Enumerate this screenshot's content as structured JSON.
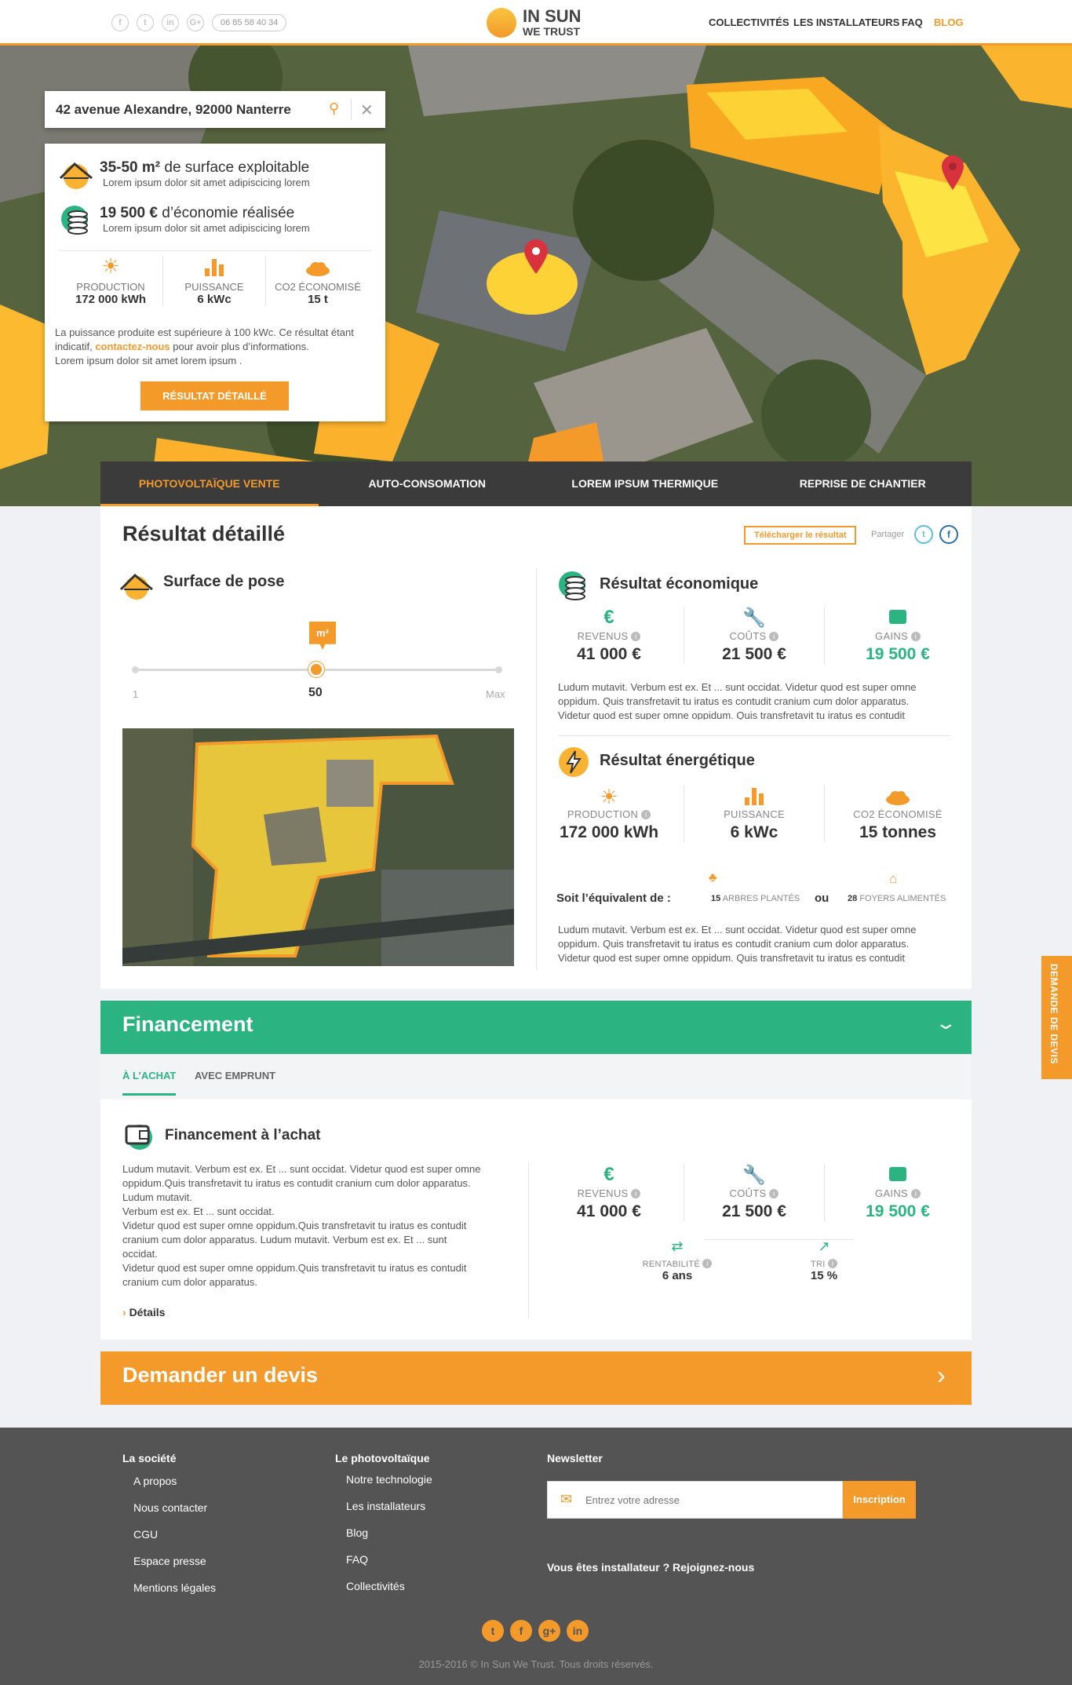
{
  "header": {
    "phone": "06 85 58 40 34",
    "logo_top": "IN SUN",
    "logo_bottom": "WE TRUST",
    "social": [
      "f",
      "t",
      "in",
      "G+"
    ],
    "nav": [
      "COLLECTIVITÉS",
      "LES INSTALLATEURS",
      "FAQ",
      "BLOG"
    ]
  },
  "search": {
    "value": "42 avenue Alexandre, 92000 Nanterre"
  },
  "summary": {
    "surface_bold": "35-50 m²",
    "surface_rest": " de surface exploitable",
    "surface_sub": "Lorem ipsum dolor sit amet adipiscicing lorem",
    "eco_bold": "19 500 €",
    "eco_rest": " d’économie réalisée",
    "eco_sub": "Lorem ipsum dolor sit amet adipiscicing lorem",
    "stats": [
      {
        "label": "PRODUCTION",
        "value": "172 000 kWh"
      },
      {
        "label": "PUISSANCE",
        "value": "6 kWc"
      },
      {
        "label": "CO2 ÉCONOMISÉ",
        "value": "15 t"
      }
    ],
    "note_1": "La puissance produite est supérieure à 100 kWc. Ce résultat étant",
    "note_2a": "indicatif, ",
    "note_link": "contactez-nous",
    "note_2b": " pour avoir plus d’informations.",
    "note_3": "Lorem ipsum dolor sit amet lorem ipsum .",
    "button": "RÉSULTAT DÉTAILLÉ"
  },
  "tabs": [
    "PHOTOVOLTAÏQUE VENTE",
    "AUTO-CONSOMATION",
    "LOREM IPSUM THERMIQUE",
    "REPRISE DE CHANTIER"
  ],
  "result": {
    "title": "Résultat détaillé",
    "download": "Télécharger le résultat",
    "share": "Partager",
    "surface_title": "Surface de pose",
    "slider_unit": "m²",
    "slider_min": "1",
    "slider_value": "50",
    "slider_max": "Max",
    "slider_level": 0.5,
    "eco_title": "Résultat économique",
    "eco": [
      {
        "label": "REVENUS",
        "value": "41 000 €"
      },
      {
        "label": "COÛTS",
        "value": "21 500 €"
      },
      {
        "label": "GAINS",
        "value": "19 500 €"
      }
    ],
    "eco_text": [
      "Ludum mutavit. Verbum est ex. Et ... sunt occidat. Videtur quod est super omne",
      "oppidum. Quis transfretavit tu iratus es contudit cranium cum dolor apparatus.",
      "Videtur quod est super omne oppidum. Quis transfretavit tu iratus es contudit"
    ],
    "energy_title": "Résultat énergétique",
    "energy": [
      {
        "label": "PRODUCTION",
        "value": "172 000 kWh"
      },
      {
        "label": "PUISSANCE",
        "value": "6 kWc"
      },
      {
        "label": "CO2 ÉCONOMISÉ",
        "value": "15 tonnes"
      }
    ],
    "equiv_label": "Soit l’équivalent de :",
    "trees_n": "15",
    "trees": "ARBRES PLANTÉS",
    "or": "ou",
    "homes_n": "28",
    "homes": "FOYERS ALIMENTÉS",
    "energy_text": [
      "Ludum mutavit. Verbum est ex. Et ... sunt occidat. Videtur quod est super omne",
      "oppidum. Quis transfretavit tu iratus es contudit cranium cum dolor apparatus.",
      "Videtur quod est super omne oppidum. Quis transfretavit tu iratus es contudit"
    ]
  },
  "financing": {
    "title": "Financement",
    "tabs": [
      "À L’ACHAT",
      "AVEC EMPRUNT"
    ],
    "sub_title": "Financement à l’achat",
    "text": [
      "Ludum mutavit. Verbum est ex. Et ... sunt occidat. Videtur quod est super omne",
      "oppidum.Quis transfretavit tu iratus es contudit cranium cum dolor apparatus.",
      "Ludum mutavit.",
      "Verbum est ex. Et ... sunt occidat.",
      "Videtur quod est super omne oppidum.Quis transfretavit tu iratus es contudit",
      "cranium cum dolor apparatus. Ludum mutavit. Verbum est ex. Et ... sunt",
      "occidat.",
      "Videtur quod est super omne oppidum.Quis transfretavit tu iratus es contudit",
      "cranium cum dolor apparatus."
    ],
    "details": "Détails",
    "kpis": [
      {
        "label": "REVENUS",
        "value": "41 000 €"
      },
      {
        "label": "COÛTS",
        "value": "21 500 €"
      },
      {
        "label": "GAINS",
        "value": "19 500 €"
      }
    ],
    "small": [
      {
        "label": "RENTABILITÉ",
        "value": "6 ans"
      },
      {
        "label": "TRI",
        "value": "15 %"
      }
    ]
  },
  "cta": {
    "label": "Demander un devis"
  },
  "side_tab": "DEMANDE DE DEVIS",
  "footer": {
    "col1_title": "La société",
    "col1": [
      "A propos",
      "Nous contacter",
      "CGU",
      "Espace presse",
      "Mentions légales"
    ],
    "col2_title": "Le photovoltaïque",
    "col2": [
      "Notre technologie",
      "Les installateurs",
      "Blog",
      "FAQ",
      "Collectivités"
    ],
    "newsletter_title": "Newsletter",
    "newsletter_placeholder": "Entrez votre adresse",
    "newsletter_button": "Inscription",
    "installer": "Vous êtes installateur ? Rejoignez-nous",
    "social": [
      "t",
      "f",
      "g+",
      "in"
    ],
    "copyright": "2015-2016 © In Sun We Trust. Tous droits réservés."
  },
  "colors": {
    "accent": "#f39a2b",
    "green": "#2bb381",
    "dark": "#3b3b3b",
    "footer": "#545454"
  }
}
